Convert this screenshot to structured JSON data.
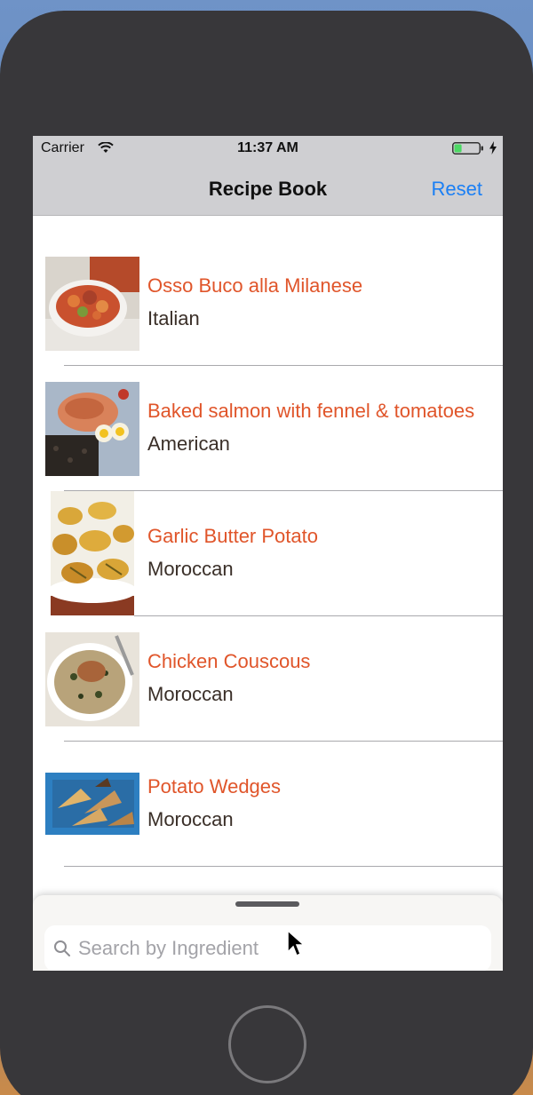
{
  "status_bar": {
    "carrier": "Carrier",
    "time": "11:37 AM",
    "battery_level": 0.3
  },
  "nav": {
    "title": "Recipe Book",
    "reset_label": "Reset"
  },
  "recipes": [
    {
      "name": "Osso Buco alla Milanese",
      "cuisine": "Italian",
      "image": "osso-buco-photo"
    },
    {
      "name": "Baked salmon with fennel & tomatoes",
      "cuisine": "American",
      "image": "baked-salmon-photo"
    },
    {
      "name": "Garlic Butter Potato",
      "cuisine": "Moroccan",
      "image": "garlic-butter-potato-photo"
    },
    {
      "name": "Chicken Couscous",
      "cuisine": "Moroccan",
      "image": "chicken-couscous-photo"
    },
    {
      "name": "Potato Wedges",
      "cuisine": "Moroccan",
      "image": "potato-wedges-photo"
    }
  ],
  "search": {
    "placeholder": "Search by Ingredient",
    "value": ""
  },
  "colors": {
    "accent": "#1a7ff5",
    "recipe_name": "#e0552a",
    "nav_bar": "#cfcfd2"
  }
}
